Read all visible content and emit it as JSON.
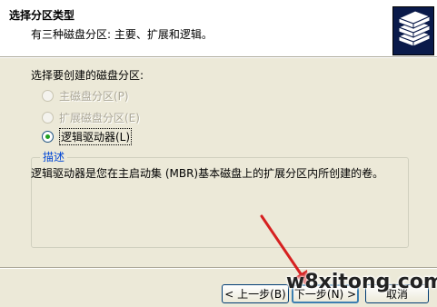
{
  "header": {
    "title": "选择分区类型",
    "subtitle": "有三种磁盘分区: 主要、扩展和逻辑。",
    "logo_icon": "disk-stack-icon"
  },
  "main": {
    "prompt": "选择要创建的磁盘分区:",
    "options": [
      {
        "label": "主磁盘分区(P)",
        "selected": false,
        "enabled": false
      },
      {
        "label": "扩展磁盘分区(E)",
        "selected": false,
        "enabled": false
      },
      {
        "label": "逻辑驱动器(L)",
        "selected": true,
        "enabled": true
      }
    ],
    "description": {
      "legend": "描述",
      "text": "逻辑驱动器是您在主启动集 (MBR)基本磁盘上的扩展分区内所创建的卷。"
    }
  },
  "footer": {
    "back_label": "< 上一步(B)",
    "next_label": "下一步(N) >",
    "cancel_label": "取消"
  },
  "watermark": "w8xitong.com",
  "colors": {
    "accent": "#0046d5",
    "dialog_bg": "#ece9d8",
    "arrow": "#d62020",
    "logo_bg": "#0a1a4a"
  }
}
